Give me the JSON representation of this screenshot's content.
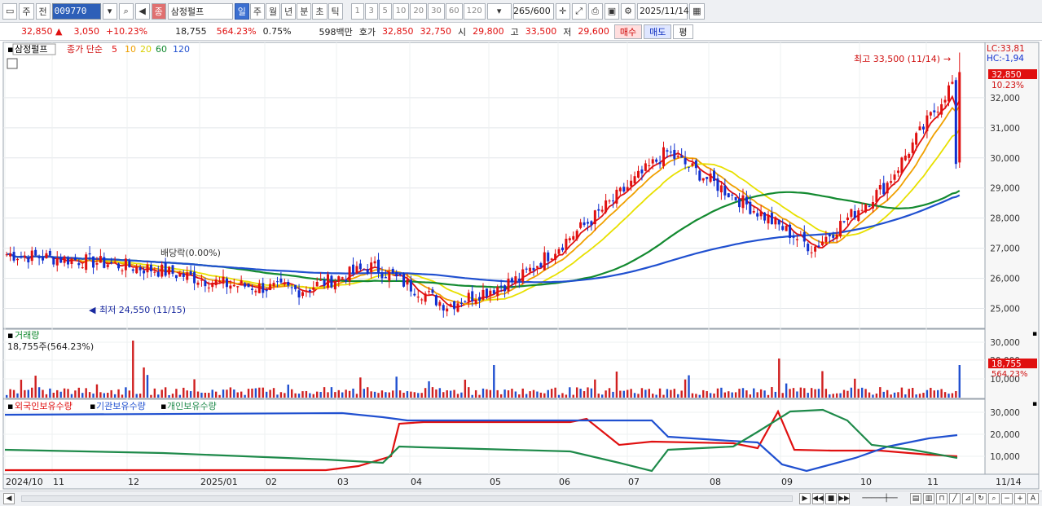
{
  "toolbar": {
    "type_label": "주",
    "prev_label": "전",
    "code": "009770",
    "stock_name": "삼정펄프",
    "stock_badge": "종",
    "periods": [
      "일",
      "주",
      "월",
      "년",
      "분",
      "초",
      "틱"
    ],
    "active_period": "일",
    "minute_options": [
      "1",
      "3",
      "5",
      "10",
      "20",
      "30",
      "60",
      "120"
    ],
    "count": "265",
    "count_max": "/600",
    "date": "2025/11/14"
  },
  "quote": {
    "price": "32,850",
    "change": "3,050",
    "change_pct": "+10.23%",
    "volume": "18,755",
    "volume_pct": "564.23%",
    "turnover_pct": "0.75%",
    "amount": "598백만",
    "bid_label": "호가",
    "ask": "32,850",
    "bid": "32,750",
    "open_label": "시",
    "open": "29,800",
    "high_label": "고",
    "high": "33,500",
    "low_label": "저",
    "low": "29,600",
    "buy_label": "매수",
    "sell_label": "매도",
    "eval_label": "평"
  },
  "price_panel": {
    "title": "삼정펄프",
    "ma_label": "종가 단순",
    "ma_periods": [
      "5",
      "10",
      "20",
      "60",
      "120"
    ],
    "ma_colors": [
      "#e01010",
      "#f0a000",
      "#e8e000",
      "#138a30",
      "#2050d0"
    ],
    "high_note": "최고 33,500 (11/14)",
    "low_note": "최저 24,550 (11/15)",
    "dividend_note": "배당락(0.00%)",
    "lc_label": "LC:33,81",
    "hc_label": "HC:-1,94",
    "last_price_tag": "32,850",
    "last_pct_tag": "10.23%",
    "y_ticks": [
      "32,000",
      "31,000",
      "30,000",
      "29,000",
      "28,000",
      "27,000",
      "26,000",
      "25,000"
    ]
  },
  "volume_panel": {
    "title": "거래량",
    "subtitle": "18,755주(564.23%)",
    "y_ticks": [
      "30,000",
      "20,000",
      "10,000"
    ],
    "last_tag": "18,755",
    "last_pct_tag": "564.23%"
  },
  "holding_panel": {
    "legend": [
      "외국인보유수량",
      "기관보유수량",
      "개인보유수량"
    ],
    "legend_colors": [
      "#e01010",
      "#2050d0",
      "#1e8a4a"
    ],
    "y_ticks": [
      "30,000",
      "20,000",
      "10,000"
    ]
  },
  "x_axis": {
    "labels": [
      "2024/10",
      "11",
      "12",
      "2025/01",
      "02",
      "03",
      "04",
      "05",
      "06",
      "07",
      "08",
      "09",
      "10",
      "11"
    ],
    "last_date": "11/14"
  },
  "chart_data": {
    "type": "candlestick",
    "price_keypoints": [
      {
        "date": "2024/10",
        "close": 26800
      },
      {
        "date": "2024/11",
        "close": 26600
      },
      {
        "date": "2024/12",
        "close": 26300
      },
      {
        "date": "2025/01",
        "close": 25800
      },
      {
        "date": "2025/02",
        "close": 25600
      },
      {
        "date": "2025/03",
        "close": 26400
      },
      {
        "date": "2025/04",
        "close": 25100
      },
      {
        "date": "2025/05",
        "close": 26000
      },
      {
        "date": "2025/06",
        "close": 28000
      },
      {
        "date": "2025/07",
        "close": 30200
      },
      {
        "date": "2025/08",
        "close": 28600
      },
      {
        "date": "2025/09",
        "close": 27000
      },
      {
        "date": "2025/10",
        "close": 29100
      },
      {
        "date": "2025/11/14",
        "close": 32850
      }
    ],
    "high": 33500,
    "low": 24550,
    "ylim": [
      24500,
      34000
    ]
  }
}
